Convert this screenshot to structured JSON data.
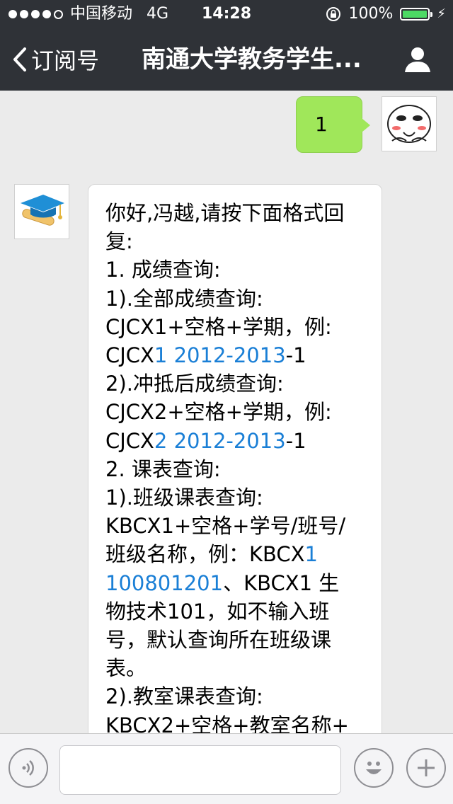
{
  "status_bar": {
    "carrier": "中国移动",
    "network": "4G",
    "time": "14:28",
    "battery": "100%",
    "battery_level": 1.0
  },
  "nav": {
    "back_label": "订阅号",
    "title": "南通大学教务学生..."
  },
  "messages": {
    "outgoing": {
      "text": "1"
    },
    "incoming": {
      "segments": [
        [
          "你好,冯越,请按下面格式回"
        ],
        [
          "复:"
        ],
        [
          "1. 成绩查询:"
        ],
        [
          "1).全部成绩查询:"
        ],
        [
          "CJCX1+空格+学期，例:"
        ],
        [
          "CJCX",
          {
            "link": "1 2012-2013"
          },
          "-1"
        ],
        [
          "2).冲抵后成绩查询:"
        ],
        [
          "CJCX2+空格+学期，例:"
        ],
        [
          "CJCX",
          {
            "link": "2 2012-2013"
          },
          "-1"
        ],
        [
          "2. 课表查询:"
        ],
        [
          "1).班级课表查询:"
        ],
        [
          "KBCX1+空格+学号/班号/"
        ],
        [
          "班级名称，例：KBCX",
          {
            "link": "1"
          }
        ],
        [
          {
            "link": "100801201"
          },
          "、KBCX1 生"
        ],
        [
          "物技术101，如不输入班"
        ],
        [
          "号，默认查询所在班级课"
        ],
        [
          "表。"
        ],
        [
          "2).教室课表查询:"
        ],
        [
          "KBCX2+空格+教室名称+"
        ]
      ]
    }
  },
  "input_bar": {
    "placeholder": ""
  },
  "colors": {
    "nav_bg": "#2f3237",
    "chat_bg": "#ebebeb",
    "outgoing_bubble": "#a0e75a",
    "link": "#1a7fd6",
    "battery_green": "#4cd964"
  }
}
